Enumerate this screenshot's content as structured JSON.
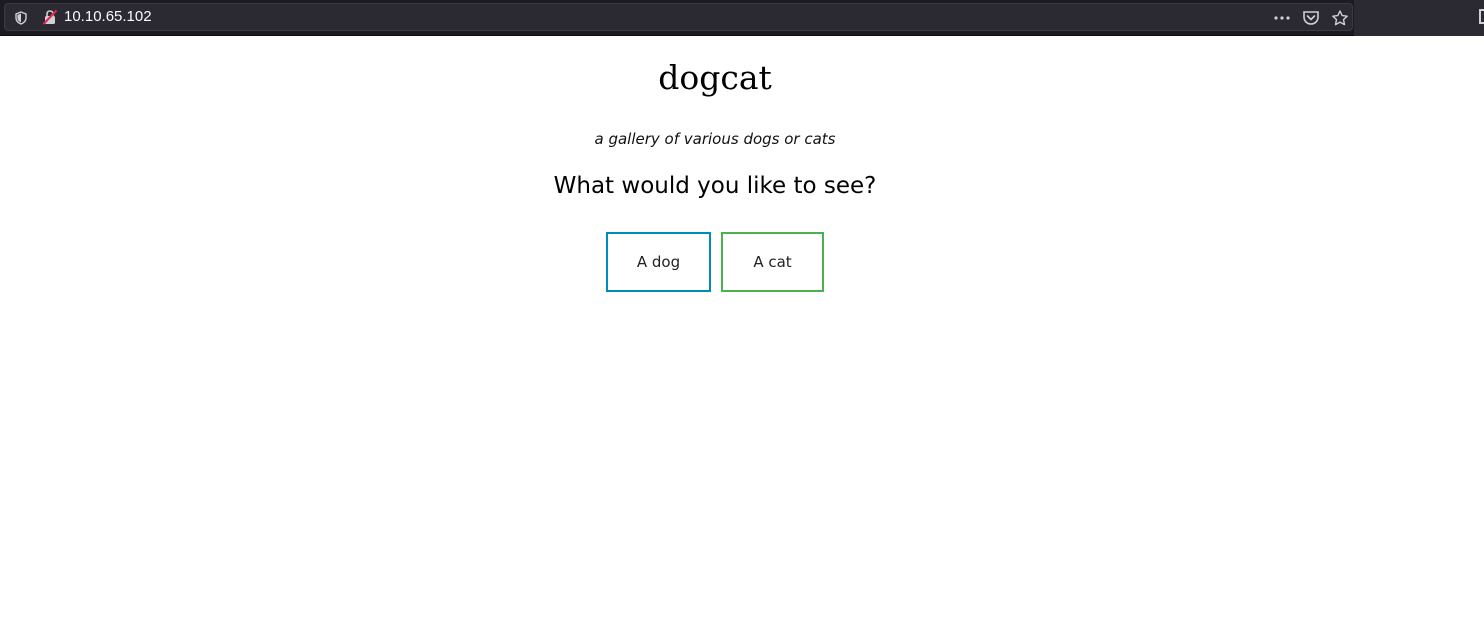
{
  "browser": {
    "url": "10.10.65.102",
    "icons": [
      "shield-icon",
      "insecure-lock-icon",
      "more-icon",
      "pocket-icon",
      "star-icon"
    ]
  },
  "page": {
    "title": "dogcat",
    "tagline": "a gallery of various dogs or cats",
    "question": "What would you like to see?",
    "buttons": {
      "dog_label": "A dog",
      "cat_label": "A cat"
    }
  },
  "colors": {
    "dog_button_border": "#008cba",
    "cat_button_border": "#4caf50",
    "browser_bar": "#1c1b22"
  }
}
